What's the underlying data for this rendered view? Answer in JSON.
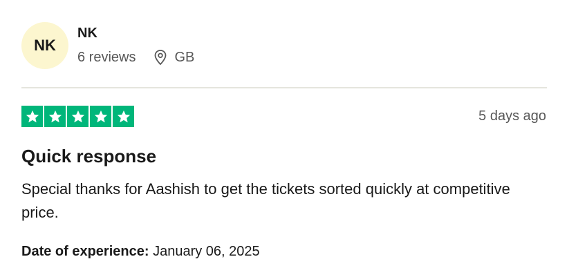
{
  "reviewer": {
    "initials": "NK",
    "name": "NK",
    "review_count": "6 reviews",
    "country": "GB",
    "avatar_color": "#fcf6cf",
    "location_icon": "location-pin-icon"
  },
  "review": {
    "rating": 5,
    "max_rating": 5,
    "star_color": "#00b67a",
    "posted": "5 days ago",
    "title": "Quick response",
    "body": "Special thanks for Aashish to get the tickets sorted quickly at competitive price.",
    "experience_label": "Date of experience:",
    "experience_date": "January 06, 2025"
  }
}
